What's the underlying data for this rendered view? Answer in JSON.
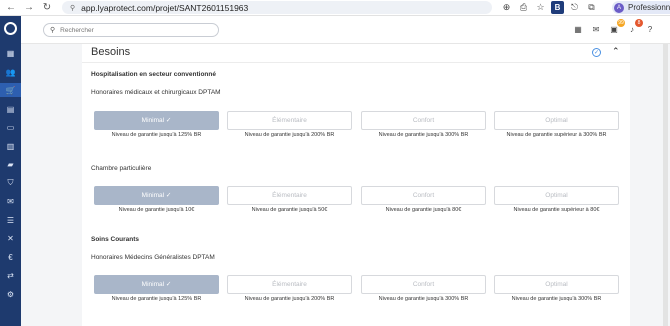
{
  "browser": {
    "url": "app.lyaprotect.com/projet/SANT2601151963",
    "profile_initial": "A",
    "profile_label": "Professionne"
  },
  "search": {
    "placeholder": "Rechercher"
  },
  "badges": {
    "orders": "99",
    "notifications": "8"
  },
  "colors": {
    "sidebar": "#1e3a6e",
    "selected_option": "#a9b6c9",
    "badge_orange": "#f5a623",
    "badge_red": "#e4572e"
  },
  "page": {
    "title": "Besoins"
  },
  "sections": [
    {
      "title": "Hospitalisation en secteur conventionné",
      "rows": [
        {
          "label": "Honoraires médicaux et chirurgicaux DPTAM",
          "options": [
            "Minimal ✓",
            "Élémentaire",
            "Confort",
            "Optimal"
          ],
          "captions": [
            "Niveau de garantie jusqu'à 125% BR",
            "Niveau de garantie jusqu'à 200% BR",
            "Niveau de garantie jusqu'à 300% BR",
            "Niveau de garantie supérieur à 300% BR"
          ]
        },
        {
          "label": "Chambre particulière",
          "options": [
            "Minimal ✓",
            "Élémentaire",
            "Confort",
            "Optimal"
          ],
          "captions": [
            "Niveau de garantie jusqu'à 10€",
            "Niveau de garantie jusqu'à 50€",
            "Niveau de garantie jusqu'à 80€",
            "Niveau de garantie supérieur à 80€"
          ]
        }
      ]
    },
    {
      "title": "Soins Courants",
      "rows": [
        {
          "label": "Honoraires Médecins Généralistes DPTAM",
          "options": [
            "Minimal ✓",
            "Élémentaire",
            "Confort",
            "Optimal"
          ],
          "captions": [
            "Niveau de garantie jusqu'à 125% BR",
            "Niveau de garantie jusqu'à 200% BR",
            "Niveau de garantie jusqu'à 300% BR",
            "Niveau de garantie jusqu'à 300% BR"
          ]
        }
      ]
    }
  ]
}
